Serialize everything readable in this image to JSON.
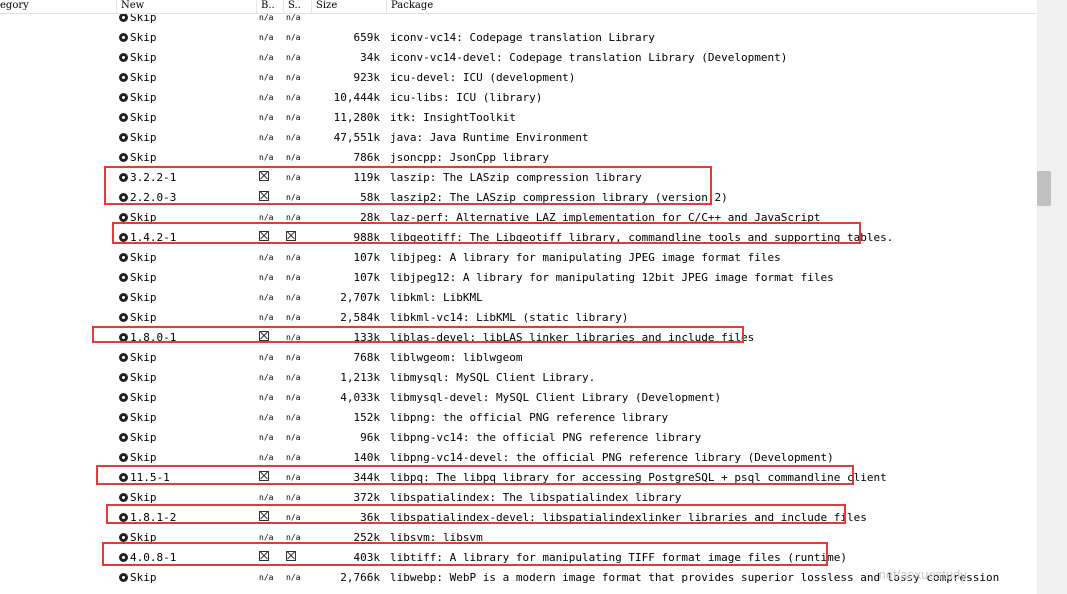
{
  "columns": {
    "category": "egory",
    "new": "New",
    "b": "B..",
    "s": "S..",
    "size": "Size",
    "package": "Package"
  },
  "rows": [
    {
      "new": "Skip",
      "b": "n/a",
      "s": "n/a",
      "size": "",
      "pkg": ""
    },
    {
      "new": "Skip",
      "b": "n/a",
      "s": "n/a",
      "size": "659k",
      "pkg": "iconv-vc14: Codepage translation Library"
    },
    {
      "new": "Skip",
      "b": "n/a",
      "s": "n/a",
      "size": "34k",
      "pkg": "iconv-vc14-devel: Codepage translation Library (Development)"
    },
    {
      "new": "Skip",
      "b": "n/a",
      "s": "n/a",
      "size": "923k",
      "pkg": "icu-devel: ICU (development)"
    },
    {
      "new": "Skip",
      "b": "n/a",
      "s": "n/a",
      "size": "10,444k",
      "pkg": "icu-libs: ICU (library)"
    },
    {
      "new": "Skip",
      "b": "n/a",
      "s": "n/a",
      "size": "11,280k",
      "pkg": "itk: InsightToolkit"
    },
    {
      "new": "Skip",
      "b": "n/a",
      "s": "n/a",
      "size": "47,551k",
      "pkg": "java: Java Runtime Environment"
    },
    {
      "new": "Skip",
      "b": "n/a",
      "s": "n/a",
      "size": "786k",
      "pkg": "jsoncpp: JsonCpp library"
    },
    {
      "new": "3.2.2-1",
      "b": "x",
      "s": "n/a",
      "size": "119k",
      "pkg": "laszip: The LASzip compression library"
    },
    {
      "new": "2.2.0-3",
      "b": "x",
      "s": "n/a",
      "size": "58k",
      "pkg": "laszip2: The LASzip compression library (version 2)"
    },
    {
      "new": "Skip",
      "b": "n/a",
      "s": "n/a",
      "size": "28k",
      "pkg": "laz-perf: Alternative LAZ implementation for C/C++ and JavaScript"
    },
    {
      "new": "1.4.2-1",
      "b": "x",
      "s": "x",
      "size": "988k",
      "pkg": "libgeotiff: The Libgeotiff library, commandline tools and supporting tables."
    },
    {
      "new": "Skip",
      "b": "n/a",
      "s": "n/a",
      "size": "107k",
      "pkg": "libjpeg: A library for manipulating JPEG image format files"
    },
    {
      "new": "Skip",
      "b": "n/a",
      "s": "n/a",
      "size": "107k",
      "pkg": "libjpeg12: A library for manipulating 12bit JPEG image format files"
    },
    {
      "new": "Skip",
      "b": "n/a",
      "s": "n/a",
      "size": "2,707k",
      "pkg": "libkml: LibKML"
    },
    {
      "new": "Skip",
      "b": "n/a",
      "s": "n/a",
      "size": "2,584k",
      "pkg": "libkml-vc14: LibKML (static library)"
    },
    {
      "new": "1.8.0-1",
      "b": "x",
      "s": "n/a",
      "size": "133k",
      "pkg": "liblas-devel: libLAS linker libraries and include files"
    },
    {
      "new": "Skip",
      "b": "n/a",
      "s": "n/a",
      "size": "768k",
      "pkg": "liblwgeom: liblwgeom"
    },
    {
      "new": "Skip",
      "b": "n/a",
      "s": "n/a",
      "size": "1,213k",
      "pkg": "libmysql: MySQL Client Library."
    },
    {
      "new": "Skip",
      "b": "n/a",
      "s": "n/a",
      "size": "4,033k",
      "pkg": "libmysql-devel: MySQL Client Library (Development)"
    },
    {
      "new": "Skip",
      "b": "n/a",
      "s": "n/a",
      "size": "152k",
      "pkg": "libpng: the official PNG reference library"
    },
    {
      "new": "Skip",
      "b": "n/a",
      "s": "n/a",
      "size": "96k",
      "pkg": "libpng-vc14: the official PNG reference library"
    },
    {
      "new": "Skip",
      "b": "n/a",
      "s": "n/a",
      "size": "140k",
      "pkg": "libpng-vc14-devel: the official PNG reference library (Development)"
    },
    {
      "new": "11.5-1",
      "b": "x",
      "s": "n/a",
      "size": "344k",
      "pkg": "libpq: The libpq library for accessing PostgreSQL + psql commandline client"
    },
    {
      "new": "Skip",
      "b": "n/a",
      "s": "n/a",
      "size": "372k",
      "pkg": "libspatialindex: The libspatialindex library"
    },
    {
      "new": "1.8.1-2",
      "b": "x",
      "s": "n/a",
      "size": "36k",
      "pkg": "libspatialindex-devel: libspatialindexlinker libraries and include files"
    },
    {
      "new": "Skip",
      "b": "n/a",
      "s": "n/a",
      "size": "252k",
      "pkg": "libsvm: libsvm"
    },
    {
      "new": "4.0.8-1",
      "b": "x",
      "s": "x",
      "size": "403k",
      "pkg": "libtiff: A library for manipulating TIFF format image files (runtime)"
    },
    {
      "new": "Skip",
      "b": "n/a",
      "s": "n/a",
      "size": "2,766k",
      "pkg": "libwebp: WebP is a modern image format that provides superior lossless and lossy compression"
    }
  ],
  "highlight_color": "#e33b3b",
  "watermark": ".net/aoxuestudy"
}
